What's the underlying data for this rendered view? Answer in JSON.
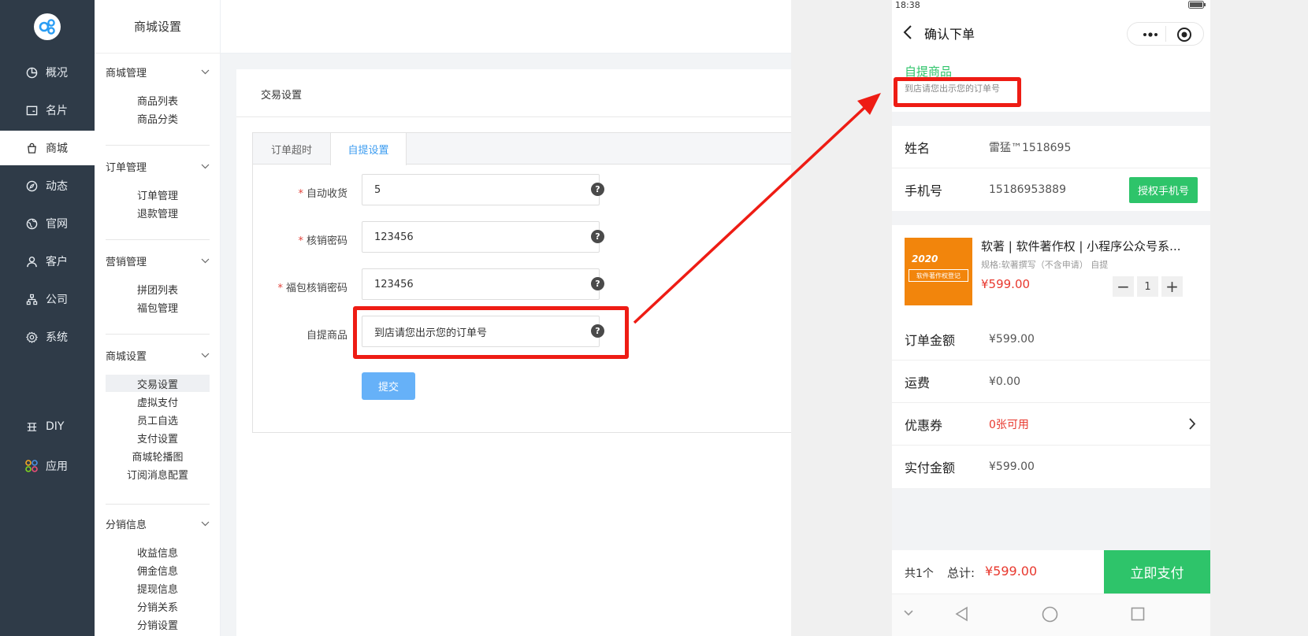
{
  "nav": {
    "items": [
      {
        "label": "概况",
        "icon": "pie-chart-icon"
      },
      {
        "label": "名片",
        "icon": "card-icon"
      },
      {
        "label": "商城",
        "icon": "bag-icon"
      },
      {
        "label": "动态",
        "icon": "compass-icon"
      },
      {
        "label": "官网",
        "icon": "globe-icon"
      },
      {
        "label": "客户",
        "icon": "user-icon"
      },
      {
        "label": "公司",
        "icon": "org-icon"
      },
      {
        "label": "系统",
        "icon": "gear-icon"
      }
    ],
    "diy_label": "DIY",
    "apps_label": "应用"
  },
  "submenu": {
    "title": "商城设置",
    "groups": [
      {
        "title": "商城管理",
        "items": [
          "商品列表",
          "商品分类"
        ]
      },
      {
        "title": "订单管理",
        "items": [
          "订单管理",
          "退款管理"
        ]
      },
      {
        "title": "营销管理",
        "items": [
          "拼团列表",
          "福包管理"
        ]
      },
      {
        "title": "商城设置",
        "items": [
          "交易设置",
          "虚拟支付",
          "员工自选",
          "支付设置",
          "商城轮播图",
          "订阅消息配置"
        ]
      },
      {
        "title": "分销信息",
        "items": [
          "收益信息",
          "佣金信息",
          "提现信息",
          "分销关系",
          "分销设置"
        ]
      }
    ]
  },
  "main": {
    "card_title": "交易设置",
    "tabs": [
      "订单超时",
      "自提设置"
    ],
    "fields": [
      {
        "label": "自动收货",
        "value": "5",
        "required": true
      },
      {
        "label": "核销密码",
        "value": "123456",
        "required": true
      },
      {
        "label": "福包核销密码",
        "value": "123456",
        "required": true
      },
      {
        "label": "自提商品",
        "value": "到店请您出示您的订单号",
        "required": false
      }
    ],
    "required_mark": "*",
    "help_mark": "?",
    "submit_label": "提交"
  },
  "phone": {
    "status_time": "18:38",
    "title": "确认下单",
    "pickup_title": "自提商品",
    "pickup_note": "到店请您出示您的订单号",
    "name_label": "姓名",
    "name_value": "雷猛™1518695",
    "phone_label": "手机号",
    "phone_value": "15186953889",
    "auth_button": "授权手机号",
    "product": {
      "title": "软著 | 软件著作权 | 小程序公众号系...",
      "spec": "规格:软著撰写（不含申请） 自提",
      "price": "¥599.00",
      "qty": "1",
      "thumb_year": "2020",
      "thumb_tag": "软件著作权登记"
    },
    "rows": [
      {
        "label": "订单金额",
        "value": "¥599.00"
      },
      {
        "label": "运费",
        "value": "¥0.00"
      },
      {
        "label": "优惠券",
        "value": "0张可用"
      },
      {
        "label": "实付金额",
        "value": "¥599.00"
      }
    ],
    "count_text": "共1个",
    "total_label": "总计:",
    "total_value": "¥599.00",
    "pay_button": "立即支付"
  },
  "colors": {
    "nav_bg": "#2f3b48",
    "accent_blue": "#3c9cf0",
    "green": "#2ec46a",
    "price_red": "#e8382e",
    "highlight_red": "#ee1c14"
  }
}
